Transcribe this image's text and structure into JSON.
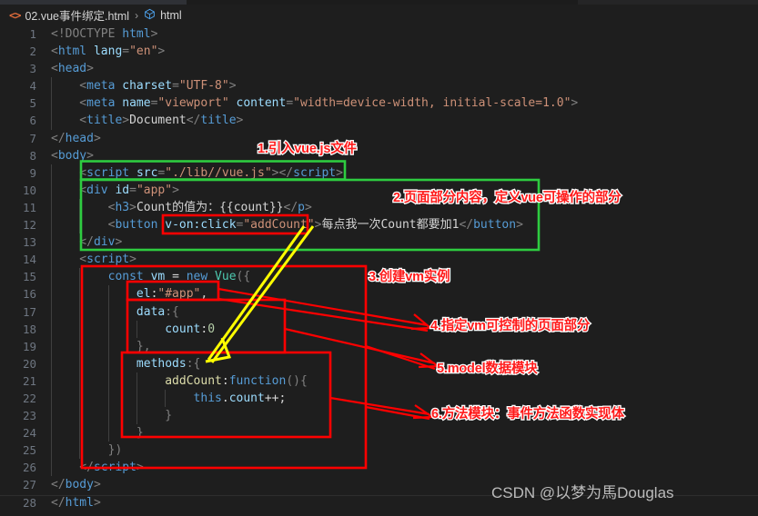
{
  "breadcrumb": {
    "file_icon": "html-tag-icon",
    "file_name": "02.vue事件绑定.html",
    "separator": "›",
    "symbol_icon": "cube-symbol-icon",
    "symbol_name": "html"
  },
  "editor": {
    "lines": [
      {
        "n": "1",
        "segments": [
          {
            "t": "<!DOCTYPE ",
            "c": "brk"
          },
          {
            "t": "html",
            "c": "tag"
          },
          {
            "t": ">",
            "c": "brk"
          }
        ],
        "indent": 0
      },
      {
        "n": "2",
        "segments": [
          {
            "t": "<",
            "c": "brk"
          },
          {
            "t": "html",
            "c": "tag"
          },
          {
            "t": " ",
            "c": "txt"
          },
          {
            "t": "lang",
            "c": "attr"
          },
          {
            "t": "=",
            "c": "brk"
          },
          {
            "t": "\"en\"",
            "c": "str"
          },
          {
            "t": ">",
            "c": "brk"
          }
        ],
        "indent": 0
      },
      {
        "n": "3",
        "segments": [
          {
            "t": "<",
            "c": "brk"
          },
          {
            "t": "head",
            "c": "tag"
          },
          {
            "t": ">",
            "c": "brk"
          }
        ],
        "indent": 0
      },
      {
        "n": "4",
        "segments": [
          {
            "t": "    <",
            "c": "brk"
          },
          {
            "t": "meta",
            "c": "tag"
          },
          {
            "t": " ",
            "c": "txt"
          },
          {
            "t": "charset",
            "c": "attr"
          },
          {
            "t": "=",
            "c": "brk"
          },
          {
            "t": "\"UTF-8\"",
            "c": "str"
          },
          {
            "t": ">",
            "c": "brk"
          }
        ],
        "indent": 1
      },
      {
        "n": "5",
        "segments": [
          {
            "t": "    <",
            "c": "brk"
          },
          {
            "t": "meta",
            "c": "tag"
          },
          {
            "t": " ",
            "c": "txt"
          },
          {
            "t": "name",
            "c": "attr"
          },
          {
            "t": "=",
            "c": "brk"
          },
          {
            "t": "\"viewport\"",
            "c": "str"
          },
          {
            "t": " ",
            "c": "txt"
          },
          {
            "t": "content",
            "c": "attr"
          },
          {
            "t": "=",
            "c": "brk"
          },
          {
            "t": "\"width=device-width, initial-scale=1.0\"",
            "c": "str"
          },
          {
            "t": ">",
            "c": "brk"
          }
        ],
        "indent": 1
      },
      {
        "n": "6",
        "segments": [
          {
            "t": "    <",
            "c": "brk"
          },
          {
            "t": "title",
            "c": "tag"
          },
          {
            "t": ">",
            "c": "brk"
          },
          {
            "t": "Document",
            "c": "txt"
          },
          {
            "t": "</",
            "c": "brk"
          },
          {
            "t": "title",
            "c": "tag"
          },
          {
            "t": ">",
            "c": "brk"
          }
        ],
        "indent": 1
      },
      {
        "n": "7",
        "segments": [
          {
            "t": "</",
            "c": "brk"
          },
          {
            "t": "head",
            "c": "tag"
          },
          {
            "t": ">",
            "c": "brk"
          }
        ],
        "indent": 0
      },
      {
        "n": "8",
        "segments": [
          {
            "t": "<",
            "c": "brk"
          },
          {
            "t": "body",
            "c": "tag"
          },
          {
            "t": ">",
            "c": "brk"
          }
        ],
        "indent": 0
      },
      {
        "n": "9",
        "segments": [
          {
            "t": "    <",
            "c": "brk"
          },
          {
            "t": "script",
            "c": "tag"
          },
          {
            "t": " ",
            "c": "txt"
          },
          {
            "t": "src",
            "c": "attr"
          },
          {
            "t": "=",
            "c": "brk"
          },
          {
            "t": "\"./lib//vue.js\"",
            "c": "str"
          },
          {
            "t": ">",
            "c": "brk"
          },
          {
            "t": "</",
            "c": "brk"
          },
          {
            "t": "script",
            "c": "tag"
          },
          {
            "t": ">",
            "c": "brk"
          }
        ],
        "indent": 1
      },
      {
        "n": "10",
        "segments": [
          {
            "t": "    <",
            "c": "brk"
          },
          {
            "t": "div",
            "c": "tag"
          },
          {
            "t": " ",
            "c": "txt"
          },
          {
            "t": "id",
            "c": "attr"
          },
          {
            "t": "=",
            "c": "brk"
          },
          {
            "t": "\"app\"",
            "c": "str"
          },
          {
            "t": ">",
            "c": "brk"
          }
        ],
        "indent": 1
      },
      {
        "n": "11",
        "segments": [
          {
            "t": "        <",
            "c": "brk"
          },
          {
            "t": "h3",
            "c": "tag"
          },
          {
            "t": ">",
            "c": "brk"
          },
          {
            "t": "Count的值为：{{count}}",
            "c": "txt"
          },
          {
            "t": "</",
            "c": "brk"
          },
          {
            "t": "p",
            "c": "tag"
          },
          {
            "t": ">",
            "c": "brk"
          }
        ],
        "indent": 2
      },
      {
        "n": "12",
        "segments": [
          {
            "t": "        <",
            "c": "brk"
          },
          {
            "t": "button",
            "c": "tag"
          },
          {
            "t": " ",
            "c": "txt"
          },
          {
            "t": "v-on:click",
            "c": "attr"
          },
          {
            "t": "=",
            "c": "brk"
          },
          {
            "t": "\"addCount\"",
            "c": "str"
          },
          {
            "t": ">",
            "c": "brk"
          },
          {
            "t": "每点我一次Count都要加1",
            "c": "txt"
          },
          {
            "t": "</",
            "c": "brk"
          },
          {
            "t": "button",
            "c": "tag"
          },
          {
            "t": ">",
            "c": "brk"
          }
        ],
        "indent": 2
      },
      {
        "n": "13",
        "segments": [
          {
            "t": "    </",
            "c": "brk"
          },
          {
            "t": "div",
            "c": "tag"
          },
          {
            "t": ">",
            "c": "brk"
          }
        ],
        "indent": 1
      },
      {
        "n": "14",
        "segments": [
          {
            "t": "    <",
            "c": "brk"
          },
          {
            "t": "script",
            "c": "tag"
          },
          {
            "t": ">",
            "c": "brk"
          }
        ],
        "indent": 1
      },
      {
        "n": "15",
        "segments": [
          {
            "t": "        ",
            "c": "txt"
          },
          {
            "t": "const",
            "c": "kw"
          },
          {
            "t": " ",
            "c": "txt"
          },
          {
            "t": "vm",
            "c": "prop"
          },
          {
            "t": " = ",
            "c": "punc"
          },
          {
            "t": "new",
            "c": "kw"
          },
          {
            "t": " ",
            "c": "txt"
          },
          {
            "t": "Vue",
            "c": "cls"
          },
          {
            "t": "({",
            "c": "brk"
          }
        ],
        "indent": 2
      },
      {
        "n": "16",
        "segments": [
          {
            "t": "            ",
            "c": "txt"
          },
          {
            "t": "el",
            "c": "prop"
          },
          {
            "t": ":",
            "c": "punc"
          },
          {
            "t": "\"#app\"",
            "c": "str"
          },
          {
            "t": ",",
            "c": "punc"
          }
        ],
        "indent": 3
      },
      {
        "n": "17",
        "segments": [
          {
            "t": "            ",
            "c": "txt"
          },
          {
            "t": "data",
            "c": "prop"
          },
          {
            "t": ":{",
            "c": "brk"
          }
        ],
        "indent": 3
      },
      {
        "n": "18",
        "segments": [
          {
            "t": "                ",
            "c": "txt"
          },
          {
            "t": "count",
            "c": "prop"
          },
          {
            "t": ":",
            "c": "punc"
          },
          {
            "t": "0",
            "c": "num"
          }
        ],
        "indent": 4
      },
      {
        "n": "19",
        "segments": [
          {
            "t": "            },",
            "c": "brk"
          }
        ],
        "indent": 3
      },
      {
        "n": "20",
        "segments": [
          {
            "t": "            ",
            "c": "txt"
          },
          {
            "t": "methods",
            "c": "prop"
          },
          {
            "t": ":{",
            "c": "brk"
          }
        ],
        "indent": 3
      },
      {
        "n": "21",
        "segments": [
          {
            "t": "                ",
            "c": "txt"
          },
          {
            "t": "addCount",
            "c": "fn"
          },
          {
            "t": ":",
            "c": "punc"
          },
          {
            "t": "function",
            "c": "kw"
          },
          {
            "t": "(){",
            "c": "brk"
          }
        ],
        "indent": 4
      },
      {
        "n": "22",
        "segments": [
          {
            "t": "                    ",
            "c": "txt"
          },
          {
            "t": "this",
            "c": "kw"
          },
          {
            "t": ".",
            "c": "punc"
          },
          {
            "t": "count",
            "c": "prop"
          },
          {
            "t": "++;",
            "c": "punc"
          }
        ],
        "indent": 5
      },
      {
        "n": "23",
        "segments": [
          {
            "t": "                }",
            "c": "brk"
          }
        ],
        "indent": 4
      },
      {
        "n": "24",
        "segments": [
          {
            "t": "            }",
            "c": "brk"
          }
        ],
        "indent": 3
      },
      {
        "n": "25",
        "segments": [
          {
            "t": "        })",
            "c": "brk"
          }
        ],
        "indent": 2
      },
      {
        "n": "26",
        "segments": [
          {
            "t": "    </",
            "c": "brk"
          },
          {
            "t": "script",
            "c": "tag"
          },
          {
            "t": ">",
            "c": "brk"
          }
        ],
        "indent": 1
      },
      {
        "n": "27",
        "segments": [
          {
            "t": "</",
            "c": "brk"
          },
          {
            "t": "body",
            "c": "tag"
          },
          {
            "t": ">",
            "c": "brk"
          }
        ],
        "indent": 0
      },
      {
        "n": "28",
        "segments": [
          {
            "t": "</",
            "c": "brk"
          },
          {
            "t": "html",
            "c": "tag"
          },
          {
            "t": ">",
            "c": "brk"
          }
        ],
        "indent": 0
      }
    ]
  },
  "annotations": [
    {
      "id": "1",
      "text": "1.引入vue.js文件"
    },
    {
      "id": "2",
      "text": "2.页面部分内容，定义vue可操作的部分"
    },
    {
      "id": "3",
      "text": "3.创建vm实例"
    },
    {
      "id": "4",
      "text": "4.指定vm可控制的页面部分"
    },
    {
      "id": "5",
      "text": "5.model数据模块"
    },
    {
      "id": "6",
      "text": "6.方法模块：事件方法函数实现体"
    }
  ],
  "colors": {
    "annotation_red": "#ff1a1a",
    "annotation_stroke": "#ffffff",
    "highlight_green": "#2ecc40",
    "highlight_red": "#ff0000",
    "arrow_yellow": "#ffff00",
    "editor_background": "#1e1e1e"
  },
  "watermark": {
    "text": "CSDN @以梦为馬Douglas"
  }
}
